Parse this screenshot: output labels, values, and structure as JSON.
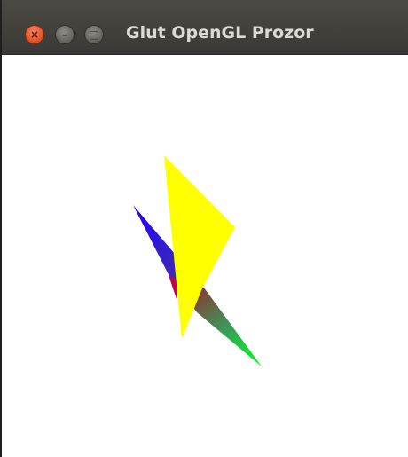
{
  "window": {
    "title": "Glut OpenGL Prozor",
    "close_glyph": "×",
    "minimize_glyph": "–",
    "maximize_glyph": "□"
  },
  "icons": {
    "close": "close-icon",
    "minimize": "minimize-icon",
    "maximize": "maximize-icon"
  },
  "colors": {
    "yellow_triangle": "#ffff00",
    "gradient_red": "#ff0000",
    "gradient_blue": "#0000ff",
    "gradient_green": "#00ff00",
    "canvas_background": "#ffffff"
  }
}
